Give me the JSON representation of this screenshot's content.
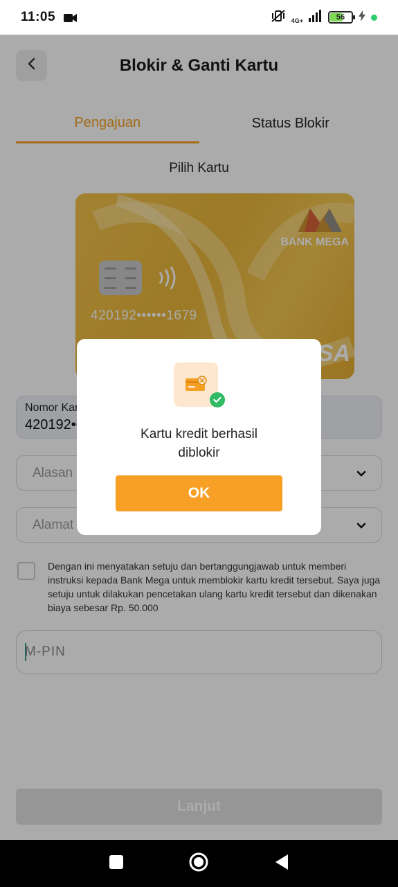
{
  "status_bar": {
    "time": "11:05",
    "network": "4G+",
    "battery": "56"
  },
  "header": {
    "title": "Blokir & Ganti Kartu"
  },
  "tabs": [
    {
      "label": "Pengajuan",
      "active": true
    },
    {
      "label": "Status Blokir",
      "active": false
    }
  ],
  "card_section": {
    "heading": "Pilih Kartu",
    "card_number": "420192••••••1679",
    "bank_name": "BANK MEGA",
    "network_name": "VISA"
  },
  "form": {
    "card_number_label": "Nomor Kartu",
    "card_number_value": "420192••••••1679",
    "reason_placeholder": "Alasan Blokir",
    "address_placeholder": "Alamat Pengiriman",
    "agreement_text": "Dengan ini menyatakan setuju dan bertanggungjawab untuk memberi instruksi kepada Bank Mega untuk memblokir kartu kredit tersebut. Saya juga setuju untuk dilakukan pencetakan ulang kartu kredit tersebut dan dikenakan biaya sebesar Rp. 50.000",
    "mpin_placeholder": "M-PIN",
    "submit_label": "Lanjut"
  },
  "modal": {
    "message_line1": "Kartu kredit berhasil",
    "message_line2": "diblokir",
    "ok_label": "OK"
  },
  "colors": {
    "accent": "#f5a024",
    "success": "#2fba63",
    "card_gold": "#e9b63a"
  }
}
